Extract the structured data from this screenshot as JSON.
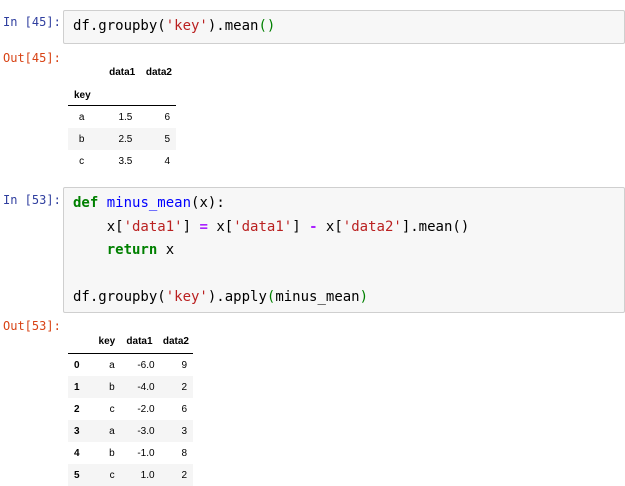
{
  "cell1": {
    "in_prompt": "In [45]:",
    "code_line1_parts": [
      "df.groupby(",
      "'key'",
      ").mean",
      "()"
    ],
    "out_prompt": "Out[45]:",
    "table": {
      "columns": [
        "data1",
        "data2"
      ],
      "index_name": "key",
      "rows": [
        {
          "idx": "a",
          "data1": "1.5",
          "data2": "6"
        },
        {
          "idx": "b",
          "data1": "2.5",
          "data2": "5"
        },
        {
          "idx": "c",
          "data1": "3.5",
          "data2": "4"
        }
      ]
    }
  },
  "cell2": {
    "in_prompt": "In [53]:",
    "code": {
      "l1_def": "def",
      "l1_name": "minus_mean",
      "l1_rest": "(x):",
      "l2_a": "    x[",
      "l2_s1": "'data1'",
      "l2_b": "] ",
      "l2_eq": "=",
      "l2_c": " x[",
      "l2_s2": "'data1'",
      "l2_d": "] ",
      "l2_minus": "-",
      "l2_e": " x[",
      "l2_s3": "'data2'",
      "l2_f": "].mean()",
      "l3_indent": "    ",
      "l3_return": "return",
      "l3_rest": " x",
      "l5_a": "df.groupby(",
      "l5_s": "'key'",
      "l5_b": ").apply",
      "l5_p1": "(",
      "l5_c": "minus_mean",
      "l5_p2": ")"
    },
    "out_prompt": "Out[53]:",
    "table": {
      "columns": [
        "",
        "key",
        "data1",
        "data2"
      ],
      "rows": [
        {
          "idx": "0",
          "key": "a",
          "data1": "-6.0",
          "data2": "9"
        },
        {
          "idx": "1",
          "key": "b",
          "data1": "-4.0",
          "data2": "2"
        },
        {
          "idx": "2",
          "key": "c",
          "data1": "-2.0",
          "data2": "6"
        },
        {
          "idx": "3",
          "key": "a",
          "data1": "-3.0",
          "data2": "3"
        },
        {
          "idx": "4",
          "key": "b",
          "data1": "-1.0",
          "data2": "8"
        },
        {
          "idx": "5",
          "key": "c",
          "data1": "1.0",
          "data2": "2"
        }
      ]
    }
  }
}
